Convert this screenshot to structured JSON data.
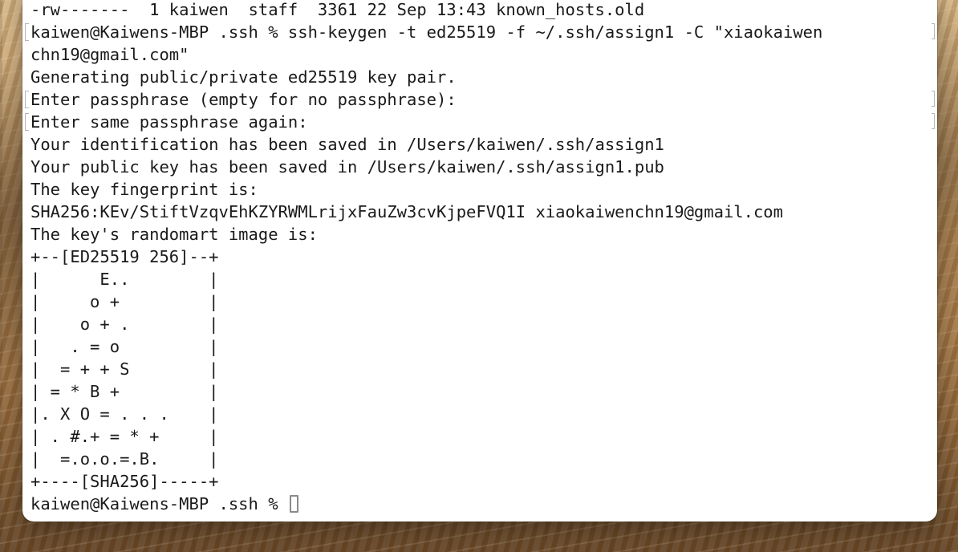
{
  "terminal": {
    "lines": [
      "-rw-------  1 kaiwen  staff  3361 22 Sep 13:43 known_hosts.old",
      "kaiwen@Kaiwens-MBP .ssh % ssh-keygen -t ed25519 -f ~/.ssh/assign1 -C \"xiaokaiwen",
      "chn19@gmail.com\"",
      "Generating public/private ed25519 key pair.",
      "Enter passphrase (empty for no passphrase):",
      "Enter same passphrase again:",
      "Your identification has been saved in /Users/kaiwen/.ssh/assign1",
      "Your public key has been saved in /Users/kaiwen/.ssh/assign1.pub",
      "The key fingerprint is:",
      "SHA256:KEv/StiftVzqvEhKZYRWMLrijxFauZw3cvKjpeFVQ1I xiaokaiwenchn19@gmail.com",
      "The key's randomart image is:",
      "+--[ED25519 256]--+",
      "|      E..        |",
      "|     o +         |",
      "|    o + .        |",
      "|   . = o         |",
      "|  = + + S        |",
      "| = * B +         |",
      "|. X O = . . .    |",
      "| . #.+ = * +     |",
      "|  =.o.o.=.B.     |",
      "+----[SHA256]-----+"
    ],
    "prompt": "kaiwen@Kaiwens-MBP .ssh % "
  }
}
